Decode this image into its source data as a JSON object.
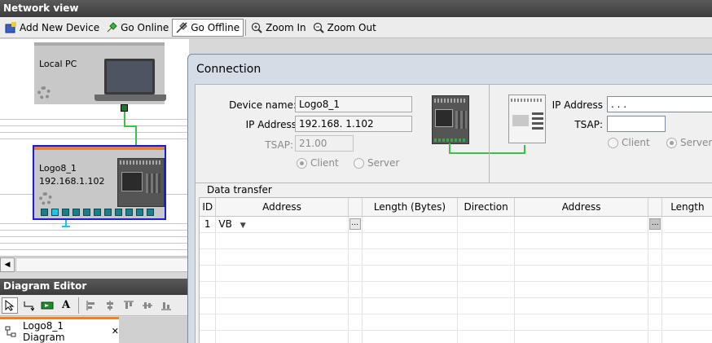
{
  "network_view": {
    "title": "Network view",
    "toolbar": {
      "add_device": "Add New Device",
      "go_online": "Go Online",
      "go_offline": "Go Offline",
      "zoom_in": "Zoom In",
      "zoom_out": "Zoom Out"
    },
    "local_pc": {
      "label": "Local PC"
    },
    "logo_device": {
      "name": "Logo8_1",
      "ip": "192.168.1.102"
    }
  },
  "diagram_editor": {
    "title": "Diagram Editor",
    "tab_label": "Logo8_1 Diagram",
    "tab_close": "✕"
  },
  "connection_dialog": {
    "title": "Connection",
    "local": {
      "device_name_label": "Device name:",
      "device_name_value": "Logo8_1",
      "ip_label": "IP Address",
      "ip_value": "192.168.  1.102",
      "tsap_label": "TSAP:",
      "tsap_value": "21.00",
      "client_label": "Client",
      "server_label": "Server",
      "selected_mode": "Client"
    },
    "remote": {
      "ip_label": "IP Address",
      "ip_value": " .   .   . ",
      "tsap_label": "TSAP:",
      "tsap_value": "",
      "client_label": "Client",
      "server_label": "Server",
      "selected_mode": "Server"
    },
    "data_transfer": {
      "label": "Data transfer",
      "columns": [
        "ID",
        "Address",
        "",
        "Length (Bytes)",
        "Direction",
        "Address",
        "",
        "Length"
      ],
      "rows": [
        {
          "id": "1",
          "address": "VB",
          "length": "",
          "direction": "",
          "remote_address": "",
          "remote_length": ""
        }
      ]
    }
  }
}
